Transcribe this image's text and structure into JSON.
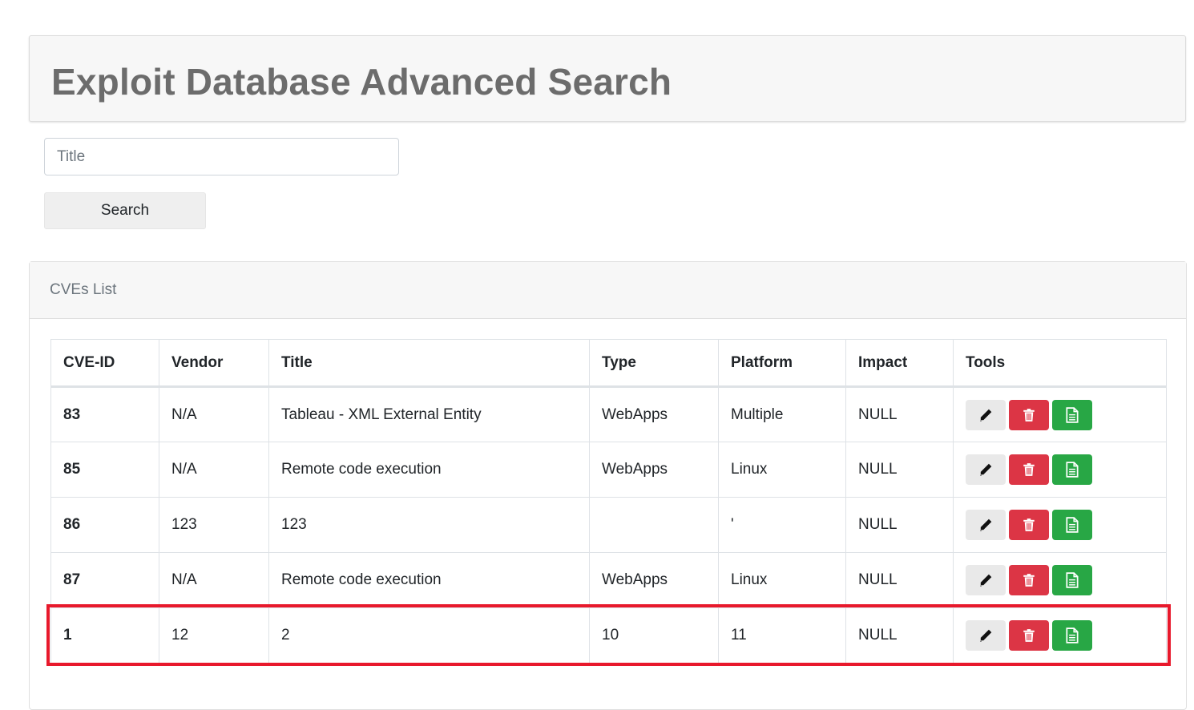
{
  "header": {
    "title": "Exploit Database Advanced Search"
  },
  "search": {
    "placeholder": "Title",
    "value": "",
    "button_label": "Search"
  },
  "card": {
    "title": "CVEs List"
  },
  "table": {
    "columns": [
      "CVE-ID",
      "Vendor",
      "Title",
      "Type",
      "Platform",
      "Impact",
      "Tools"
    ],
    "rows": [
      {
        "id": "83",
        "vendor": "N/A",
        "title": "Tableau - XML External Entity",
        "type": "WebApps",
        "platform": "Multiple",
        "impact": "NULL"
      },
      {
        "id": "85",
        "vendor": "N/A",
        "title": "Remote code execution",
        "type": "WebApps",
        "platform": "Linux",
        "impact": "NULL"
      },
      {
        "id": "86",
        "vendor": "123",
        "title": "123",
        "type": "",
        "platform": "'",
        "impact": "NULL"
      },
      {
        "id": "87",
        "vendor": "N/A",
        "title": "Remote code execution",
        "type": "WebApps",
        "platform": "Linux",
        "impact": "NULL"
      },
      {
        "id": "1",
        "vendor": "12",
        "title": "2",
        "type": "10",
        "platform": "11",
        "impact": "NULL"
      }
    ],
    "tool_icons": [
      "pencil-icon",
      "trash-icon",
      "document-icon"
    ]
  },
  "colors": {
    "edit_button": "#e9e9e9",
    "delete_button": "#dc3545",
    "document_button": "#28a745",
    "highlight_border": "#e8192c"
  }
}
